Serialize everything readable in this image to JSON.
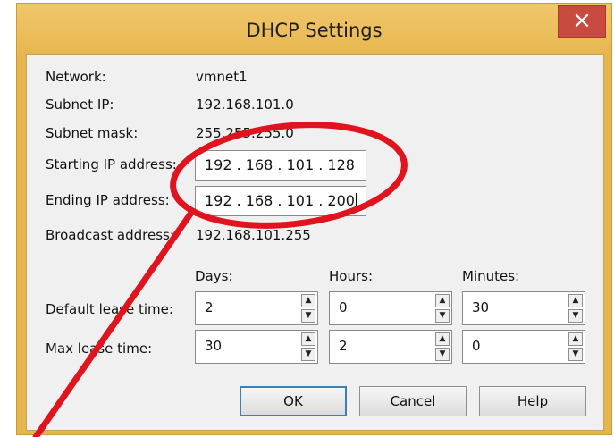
{
  "window": {
    "title": "DHCP Settings",
    "close_glyph": "×"
  },
  "info": {
    "network_label": "Network:",
    "network_value": "vmnet1",
    "subnet_ip_label": "Subnet IP:",
    "subnet_ip_value": "192.168.101.0",
    "subnet_mask_label": "Subnet mask:",
    "subnet_mask_value": "255.255.255.0",
    "starting_ip_label": "Starting IP address:",
    "starting_ip_value": "192 . 168 . 101 . 128",
    "ending_ip_label": "Ending IP address:",
    "ending_ip_value": "192 . 168 . 101 . 200",
    "broadcast_label": "Broadcast address:",
    "broadcast_value": "192.168.101.255"
  },
  "lease": {
    "headers": {
      "days": "Days:",
      "hours": "Hours:",
      "minutes": "Minutes:"
    },
    "default_label": "Default lease time:",
    "max_label": "Max lease time:",
    "default": {
      "days": "2",
      "hours": "0",
      "minutes": "30"
    },
    "max": {
      "days": "30",
      "hours": "2",
      "minutes": "0"
    }
  },
  "buttons": {
    "ok": "OK",
    "cancel": "Cancel",
    "help": "Help"
  },
  "icons": {
    "spin_up": "▲",
    "spin_down": "▼"
  },
  "annotation": {
    "color": "#e0141e"
  }
}
